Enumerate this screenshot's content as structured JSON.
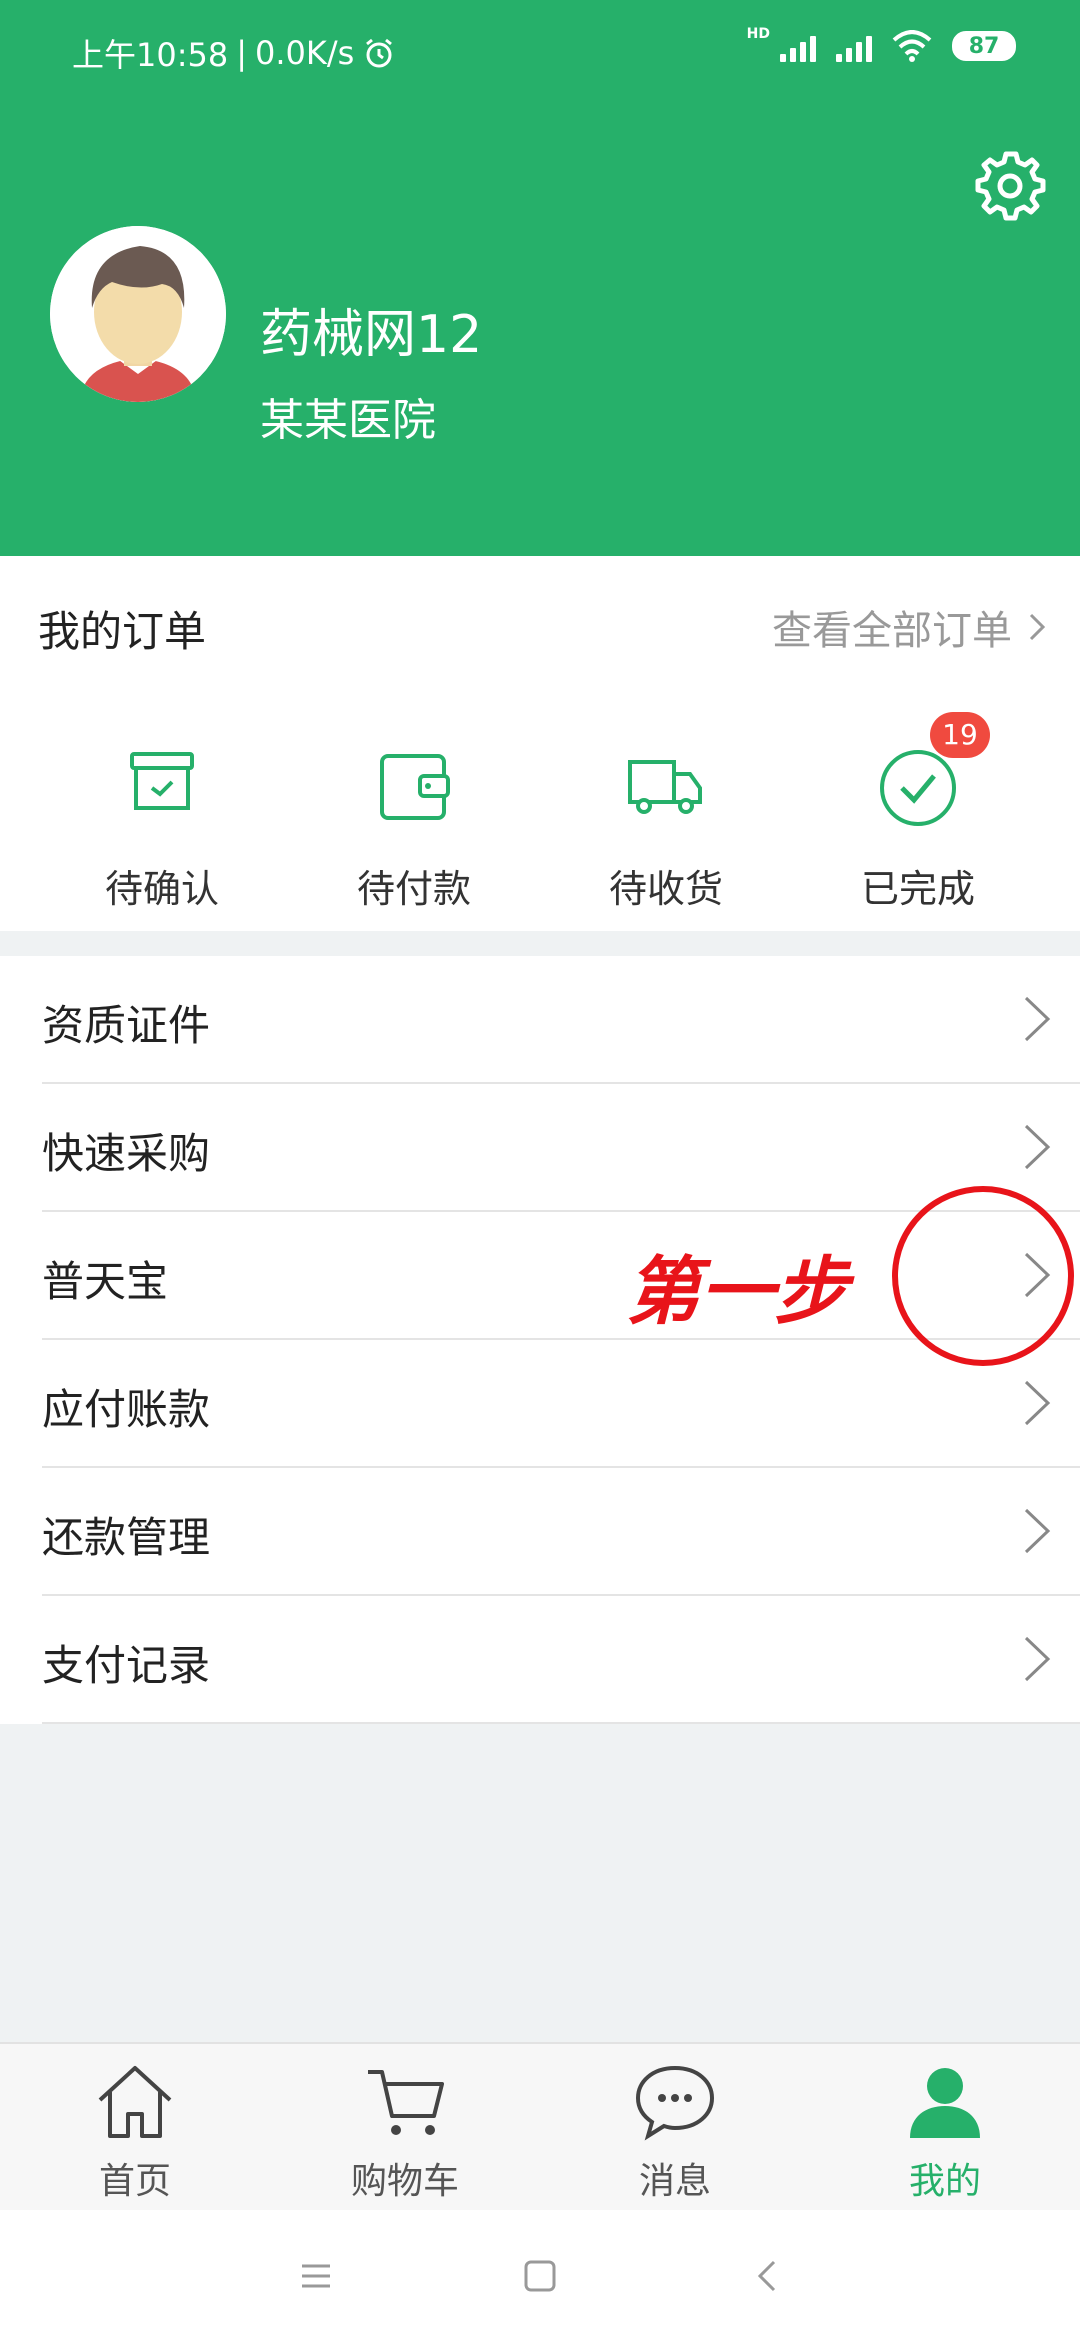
{
  "status_bar": {
    "time": "上午10:58",
    "speed": "0.0K/s",
    "hd": "HD",
    "battery": "87"
  },
  "profile": {
    "name": "药械网12",
    "organization": "某某医院"
  },
  "orders": {
    "title": "我的订单",
    "view_all": "查看全部订单",
    "items": [
      {
        "label": "待确认",
        "icon": "box-check-icon"
      },
      {
        "label": "待付款",
        "icon": "wallet-icon"
      },
      {
        "label": "待收货",
        "icon": "truck-icon"
      },
      {
        "label": "已完成",
        "icon": "check-circle-icon",
        "badge": "19"
      }
    ]
  },
  "menu": {
    "items": [
      {
        "label": "资质证件"
      },
      {
        "label": "快速采购"
      },
      {
        "label": "普天宝"
      },
      {
        "label": "应付账款"
      },
      {
        "label": "还款管理"
      },
      {
        "label": "支付记录"
      }
    ]
  },
  "annotation": {
    "text": "第一步"
  },
  "tabbar": {
    "items": [
      {
        "label": "首页",
        "icon": "home-icon"
      },
      {
        "label": "购物车",
        "icon": "cart-icon"
      },
      {
        "label": "消息",
        "icon": "message-icon"
      },
      {
        "label": "我的",
        "icon": "user-icon",
        "active": true
      }
    ]
  },
  "colors": {
    "brand": "#26b06a",
    "badge": "#f04a3f",
    "annotation": "#e8141a"
  }
}
